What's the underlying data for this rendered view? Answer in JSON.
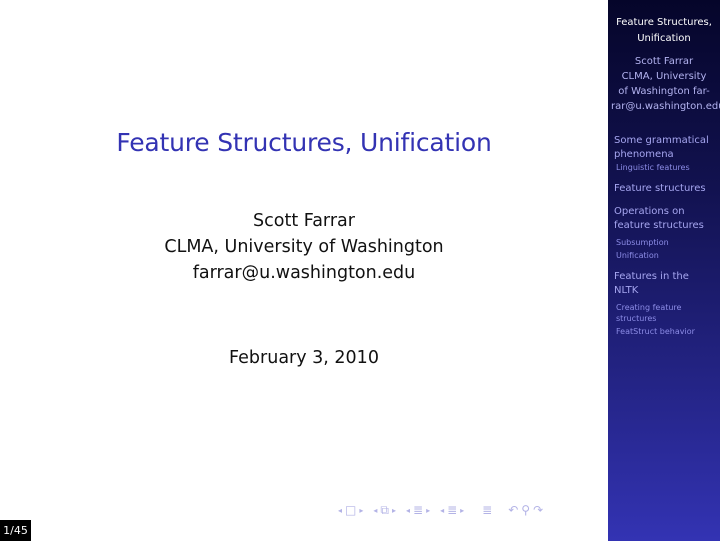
{
  "slide": {
    "title": "Feature Structures, Unification",
    "author": "Scott Farrar",
    "affiliation": "CLMA, University of Washington",
    "email": "farrar@u.washington.edu",
    "date": "February 3, 2010",
    "page_indicator": "1/45",
    "title_color": "#3333b3"
  },
  "navigation": {
    "icons": [
      {
        "name": "prev-frame-arrow",
        "glyph": "◂"
      },
      {
        "name": "frame-icon",
        "glyph": "□"
      },
      {
        "name": "next-frame-arrow",
        "glyph": "▸"
      },
      {
        "name": "prev-subsection-arrow",
        "glyph": "◂"
      },
      {
        "name": "subsection-icon",
        "glyph": "⧉"
      },
      {
        "name": "next-subsection-arrow",
        "glyph": "▸"
      },
      {
        "name": "prev-section-arrow",
        "glyph": "◂"
      },
      {
        "name": "section-icon",
        "glyph": "≣"
      },
      {
        "name": "next-section-arrow",
        "glyph": "▸"
      },
      {
        "name": "prev-doc-arrow",
        "glyph": "◂"
      },
      {
        "name": "document-icon",
        "glyph": "≣"
      },
      {
        "name": "next-doc-arrow",
        "glyph": "▸"
      },
      {
        "name": "appendix-icon",
        "glyph": "≣"
      },
      {
        "name": "undo-icon",
        "glyph": "↶"
      },
      {
        "name": "search-icon",
        "glyph": "⚲"
      },
      {
        "name": "redo-icon",
        "glyph": "↷"
      }
    ]
  },
  "sidebar": {
    "title_line1": "Feature Structures,",
    "title_line2": "Unification",
    "author_line1": "Scott Farrar",
    "author_line2": "CLMA, University",
    "author_line3": "of Washington far-",
    "author_line4": "rar@u.washington.edu",
    "sections": [
      {
        "label_line1": "Some grammatical",
        "label_line2": "phenomena",
        "subsections": [
          "Linguistic features"
        ]
      },
      {
        "label_line1": "Feature structures",
        "label_line2": "",
        "subsections": []
      },
      {
        "label_line1": "Operations on",
        "label_line2": "feature structures",
        "subsections": [
          "Subsumption",
          "Unification"
        ]
      },
      {
        "label_line1": "Features in the",
        "label_line2": "NLTK",
        "subsections": [
          "Creating feature",
          "structures",
          "FeatStruct behavior"
        ]
      }
    ]
  }
}
